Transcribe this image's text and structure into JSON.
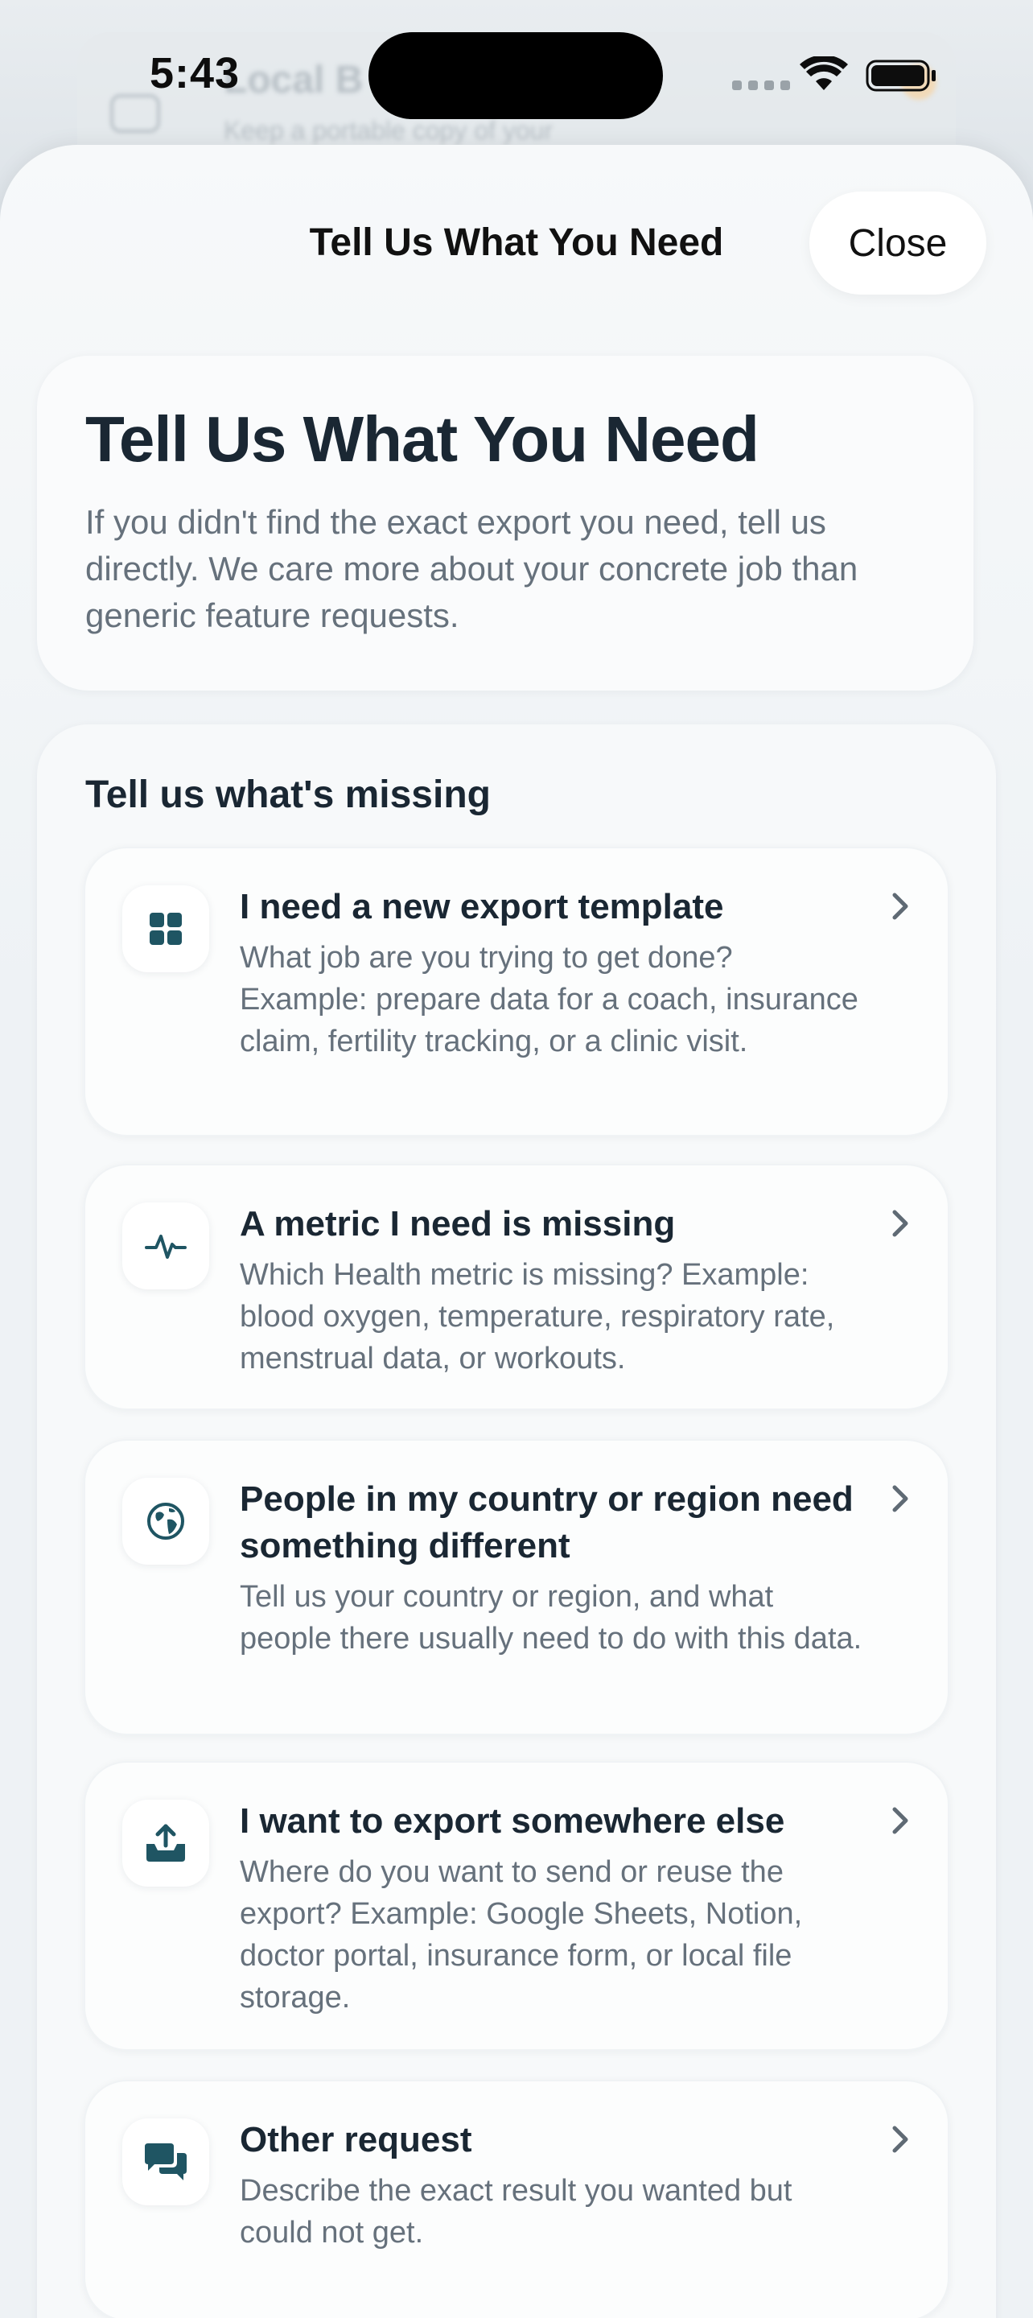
{
  "status_bar": {
    "time": "5:43"
  },
  "background_app": {
    "title": "Local B",
    "subtitle": "Keep a portable copy of your"
  },
  "sheet": {
    "nav_title": "Tell Us What You Need",
    "close_label": "Close"
  },
  "intro": {
    "title": "Tell Us What You Need",
    "body": "If you didn't find the exact export you need, tell us directly. We care more about your concrete job than generic feature requests."
  },
  "list": {
    "heading": "Tell us what's missing",
    "items": [
      {
        "icon": "grid-icon",
        "title": "I need a new export template",
        "description": "What job are you trying to get done? Example: prepare data for a coach, insurance claim, fertility tracking, or a clinic visit."
      },
      {
        "icon": "heartbeat-icon",
        "title": "A metric I need is missing",
        "description": "Which Health metric is missing? Example: blood oxygen, temperature, respiratory rate, menstrual data, or workouts."
      },
      {
        "icon": "globe-icon",
        "title": "People in my country or region need something different",
        "description": "Tell us your country or region, and what people there usually need to do with this data."
      },
      {
        "icon": "tray-upload-icon",
        "title": "I want to export somewhere else",
        "description": "Where do you want to send or reuse the export? Example: Google Sheets, Notion, doctor portal, insurance form, or local file storage."
      },
      {
        "icon": "chat-bubbles-icon",
        "title": "Other request",
        "description": "Describe the exact result you wanted but could not get."
      }
    ]
  },
  "colors": {
    "accent": "#1f5563",
    "text_primary": "#1a2733",
    "text_secondary": "#66717c"
  }
}
